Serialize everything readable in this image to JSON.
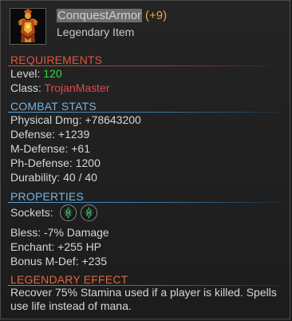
{
  "item": {
    "name": "ConquestArmor",
    "plus": "(+9)",
    "rarity": "Legendary Item"
  },
  "requirements": {
    "title": "REQUIREMENTS",
    "level_label": "Level:",
    "level_value": "120",
    "class_label": "Class:",
    "class_value": "TrojanMaster"
  },
  "combat_stats": {
    "title": "COMBAT STATS",
    "lines": [
      "Physical Dmg: +78643200",
      "Defense: +1239",
      "M-Defense: +61",
      "Ph-Defense: 1200",
      "Durability: 40 / 40"
    ]
  },
  "properties": {
    "title": "PROPERTIES",
    "sockets_label": "Sockets:",
    "lines": [
      "Bless: -7% Damage",
      "Enchant: +255 HP",
      "Bonus M-Def: +235"
    ]
  },
  "legendary_effect": {
    "title": "LEGENDARY EFFECT",
    "line1": "Recover 75% Stamina used if a player is killed. Spells",
    "line2": "use life instead of mana."
  },
  "colors": {
    "requirement_section": "#e0573c",
    "stat_section": "#6fb3e8",
    "level_value": "#3ad43a",
    "class_value": "#e24a4a",
    "plus_value": "#e8a83a"
  },
  "icons": {
    "item": "armor-item-icon",
    "socket": "empty-socket-icon"
  }
}
